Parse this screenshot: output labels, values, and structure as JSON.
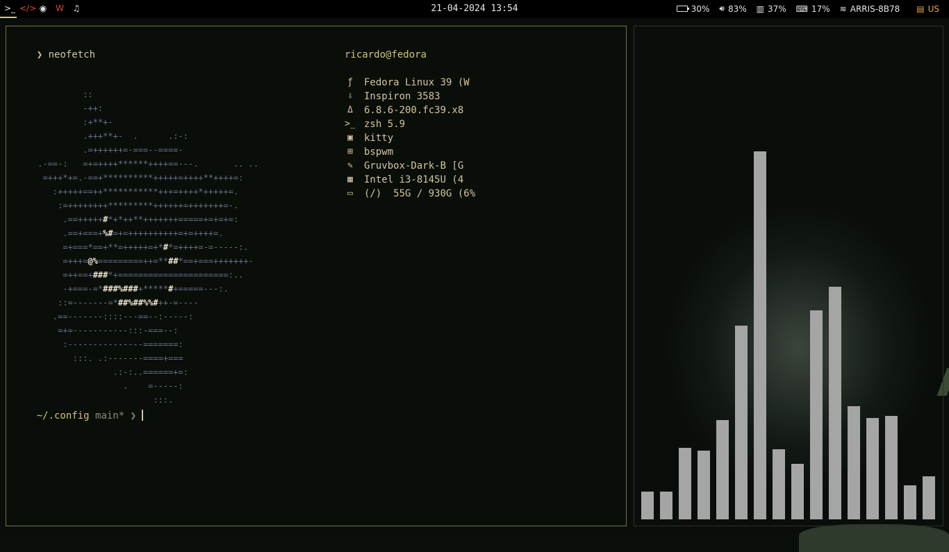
{
  "topbar": {
    "workspaces": [
      {
        "icon": "terminal-icon",
        "glyph": ">_",
        "color": "#e6e6e6"
      },
      {
        "icon": "code-icon",
        "glyph": "</>",
        "color": "#e04a3a"
      },
      {
        "icon": "globe-icon",
        "glyph": "◉",
        "color": "#e6e6e6"
      },
      {
        "icon": "document-icon",
        "glyph": "W",
        "color": "#e04a3a"
      },
      {
        "icon": "music-icon",
        "glyph": "♫",
        "color": "#e6e6e6"
      }
    ],
    "clock": "21-04-2024 13:54",
    "status": {
      "battery": "30%",
      "volume": "83%",
      "memory": "37%",
      "cpu": "17%",
      "wifi": "ARRIS-8B78",
      "keyboard": "US"
    }
  },
  "terminal": {
    "prompt_symbol": "❯",
    "command": "neofetch",
    "user_host": "ricardo@fedora",
    "ascii_art": [
      "          ::",
      "          -++:",
      "          :+**+-",
      "          .+++**+-  .      .:-:",
      "          .=++++++=-===--====-",
      " .-==-:   =+=++++******++++==---.       .. ..",
      "  =+++*+=.-==+**********+++++=++++**++++=:",
      "    :+++++==++***********+++=++++*+++++=.",
      "     :=++++++++*********++++++=+++++++=-.",
      "      .==+++++#*+*++**+++++++=====+=+=+=:",
      "      .==+===+%#=+=++++++++++=+=++++=.",
      "      =+===*==+**=+++++=+*#*=++++=-=-----:.",
      "      =+++=@%=========++=**##*==+===+++++++-",
      "      =++==+###*+======================:..",
      "      -+===-=*###%###+*****#+=====---:.",
      "     ::=-------=*##%##%%#++-=----",
      "    .==-------::::---==--:-----:",
      "     =+=-----------:::-===--:",
      "      :---------------=======:",
      "        :::. .:-------====+===",
      "                .:-:..======+=:",
      "                  .    =-----:",
      "                        :::."
    ],
    "info": [
      {
        "icon": "fedora-icon",
        "glyph": "ƒ",
        "text": "Fedora Linux 39 (W"
      },
      {
        "icon": "laptop-download-icon",
        "glyph": "⇩",
        "text": "Inspiron 3583"
      },
      {
        "icon": "linux-penguin-icon",
        "glyph": "🐧",
        "text": "6.8.6-200.fc39.x8"
      },
      {
        "icon": "shell-icon",
        "glyph": ">_",
        "text": "zsh 5.9"
      },
      {
        "icon": "terminal-window-icon",
        "glyph": "▣",
        "text": "kitty"
      },
      {
        "icon": "window-grid-icon",
        "glyph": "⊞",
        "text": "bspwm"
      },
      {
        "icon": "paint-icon",
        "glyph": "✎",
        "text": "Gruvbox-Dark-B [G"
      },
      {
        "icon": "cpu-icon",
        "glyph": "▦",
        "text": "Intel i3-8145U (4"
      },
      {
        "icon": "disk-icon",
        "glyph": "▭",
        "text": "(/)  55G / 930G (6%"
      }
    ],
    "prompt": {
      "path": "~/.config",
      "branch": "main*",
      "symbol": "❯"
    }
  },
  "visualizer": {
    "levels": [
      0.075,
      0.075,
      0.195,
      0.187,
      0.27,
      0.527,
      1.0,
      0.19,
      0.15,
      0.568,
      0.632,
      0.307,
      0.275,
      0.281,
      0.092,
      0.117
    ]
  },
  "colors": {
    "accent_yellow": "#d5c4a1",
    "prompt_path": "#d3c27a",
    "art_main": "#6b6f8c",
    "art_highlight": "#e8875f",
    "bar_color": "#a5a5a5"
  }
}
